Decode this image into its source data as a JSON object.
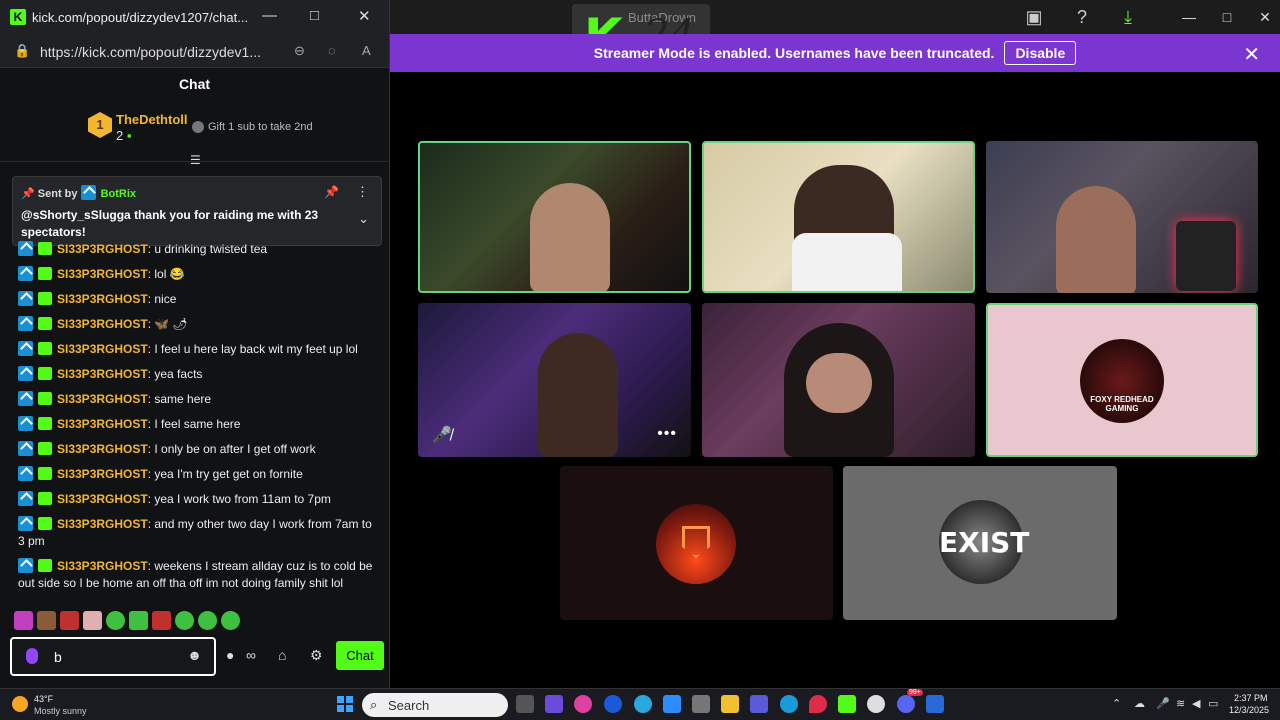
{
  "app": {
    "title": "ButtaDrown",
    "badge_letter": "K",
    "badge_number": "24"
  },
  "banner": {
    "text": "Streamer Mode is enabled. Usernames have been truncated.",
    "disable_label": "Disable"
  },
  "popout": {
    "title": "kick.com/popout/dizzydev1207/chat...",
    "url": "https://kick.com/popout/dizzydev1...",
    "chat_header": "Chat",
    "leaderboard": {
      "rank": "1",
      "name": "TheDethtoll",
      "count": "2",
      "gift_text": "Gift 1 sub to take 2nd"
    },
    "pinned": {
      "sent_by_label": "Sent by",
      "sender": "BotRix",
      "message": "@sShorty_sSlugga thank you for raiding me with 23 spectators!"
    },
    "messages": [
      {
        "user": "SI33P3RGHOST",
        "text": "u drinking twisted tea"
      },
      {
        "user": "SI33P3RGHOST",
        "text": "lol 😂"
      },
      {
        "user": "SI33P3RGHOST",
        "text": "nice"
      },
      {
        "user": "SI33P3RGHOST",
        "text": "🦋 🌶"
      },
      {
        "user": "SI33P3RGHOST",
        "text": "I feel u here lay back wit my feet up lol"
      },
      {
        "user": "SI33P3RGHOST",
        "text": "yea facts"
      },
      {
        "user": "SI33P3RGHOST",
        "text": "same here"
      },
      {
        "user": "SI33P3RGHOST",
        "text": "I feel same here"
      },
      {
        "user": "SI33P3RGHOST",
        "text": "I only be on after I get off work"
      },
      {
        "user": "SI33P3RGHOST",
        "text": "yea I'm try get get on fornite"
      },
      {
        "user": "SI33P3RGHOST",
        "text": "yea I work two from 11am to 7pm"
      },
      {
        "user": "SI33P3RGHOST",
        "text": "and my other two day I work from 7am to 3 pm"
      },
      {
        "user": "SI33P3RGHOST",
        "text": "weekens I stream allday cuz is to cold be out side so I be home an off tha off im not doing family shit lol"
      }
    ],
    "input_value": "b",
    "send_label": "Chat"
  },
  "tiles": {
    "logo_text": "FOXY REDHEAD GAMING",
    "exist_text": "EXIST"
  },
  "taskbar": {
    "temp": "43°F",
    "weather": "Mostly sunny",
    "search": "Search",
    "time": "2:37 PM",
    "date": "12/3/2025",
    "notif_count": "99+"
  },
  "colors": {
    "kick_green": "#53fc18",
    "banner_purple": "#7b35d1",
    "username_gold": "#f2b632",
    "tile_active_border": "#6ad47a"
  }
}
